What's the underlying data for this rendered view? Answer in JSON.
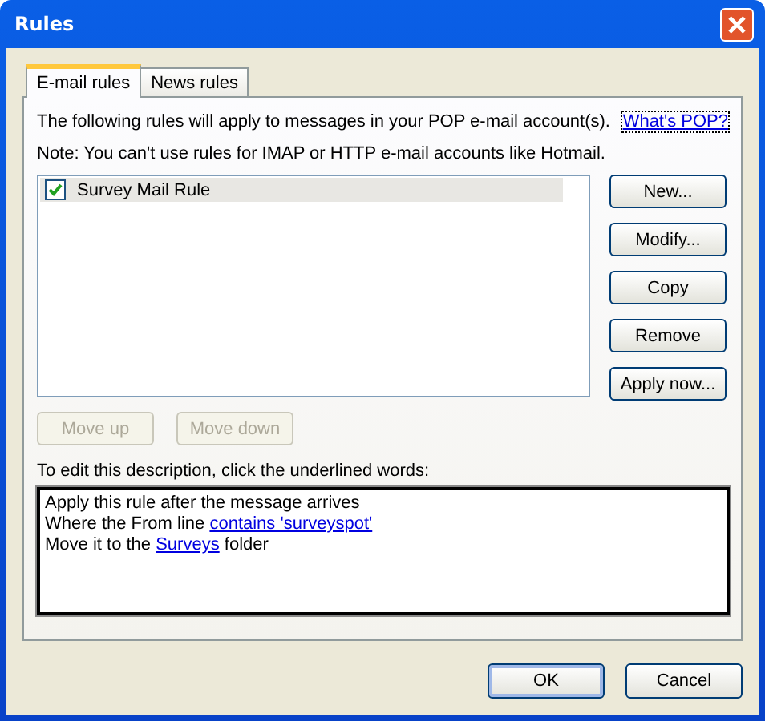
{
  "window": {
    "title": "Rules"
  },
  "tabs": [
    {
      "label": "E-mail rules",
      "selected": true
    },
    {
      "label": "News rules",
      "selected": false
    }
  ],
  "intro": "The following rules will apply to messages in your POP e-mail account(s).",
  "help_link": "What's POP?",
  "note": "Note: You can't use rules for IMAP or HTTP e-mail accounts like Hotmail.",
  "rules": [
    {
      "name": "Survey Mail Rule",
      "checked": true,
      "selected": true
    }
  ],
  "side_buttons": [
    {
      "label": "New...",
      "disabled": false
    },
    {
      "label": "Modify...",
      "disabled": false
    },
    {
      "label": "Copy",
      "disabled": false
    },
    {
      "label": "Remove",
      "disabled": false
    },
    {
      "label": "Apply now...",
      "disabled": false
    }
  ],
  "move_buttons": [
    {
      "label": "Move up",
      "disabled": true
    },
    {
      "label": "Move down",
      "disabled": true
    }
  ],
  "description_label": "To edit this description, click the underlined words:",
  "description": [
    [
      {
        "text": "Apply this rule after the message arrives",
        "link": false
      }
    ],
    [
      {
        "text": "Where the From line ",
        "link": false
      },
      {
        "text": "contains 'surveyspot'",
        "link": true
      }
    ],
    [
      {
        "text": "Move it to the ",
        "link": false
      },
      {
        "text": "Surveys",
        "link": true
      },
      {
        "text": " folder",
        "link": false
      }
    ]
  ],
  "dialog_buttons": [
    {
      "label": "OK",
      "default": true
    },
    {
      "label": "Cancel",
      "default": false
    }
  ]
}
